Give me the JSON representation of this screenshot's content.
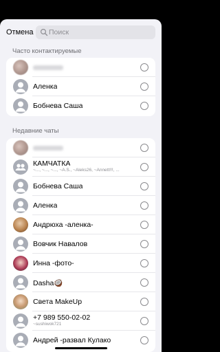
{
  "header": {
    "cancel_label": "Отмена",
    "search_placeholder": "Поиск"
  },
  "frequent": {
    "title": "Часто контактируемые",
    "items": [
      {
        "name": "",
        "avatar": "blurred-photo"
      },
      {
        "name": "Аленка",
        "avatar": "person-icon"
      },
      {
        "name": "Бобнева Саша",
        "avatar": "person-icon"
      }
    ]
  },
  "recent": {
    "title": "Недавние чаты",
    "items": [
      {
        "name": "",
        "avatar": "blurred-photo"
      },
      {
        "name": "КАМЧАТКА",
        "sub": "~..., ~..., ~..., ~A.S., ~Aleks26, ~Annett!!!, ...",
        "avatar": "group-icon"
      },
      {
        "name": "Бобнева Саша",
        "avatar": "person-icon"
      },
      {
        "name": "Аленка",
        "avatar": "person-icon"
      },
      {
        "name": "Андрюха -аленка-",
        "avatar": "photo"
      },
      {
        "name": "Вовчик Навалов",
        "avatar": "person-icon"
      },
      {
        "name": "Инна -фото-",
        "avatar": "photo"
      },
      {
        "name": "Dasha🥥",
        "avatar": "person-icon"
      },
      {
        "name": "Света MakeUp",
        "avatar": "photo"
      },
      {
        "name": "+7 989 550-02-02",
        "sub": "~sushiwok721",
        "avatar": "person-icon"
      },
      {
        "name": "Андрей -развал Кулако",
        "avatar": "person-icon"
      }
    ]
  },
  "colors": {
    "sheet_bg": "#f2f2f7",
    "avatar_gray": "#a9adb6",
    "accent_text": "#000000"
  }
}
